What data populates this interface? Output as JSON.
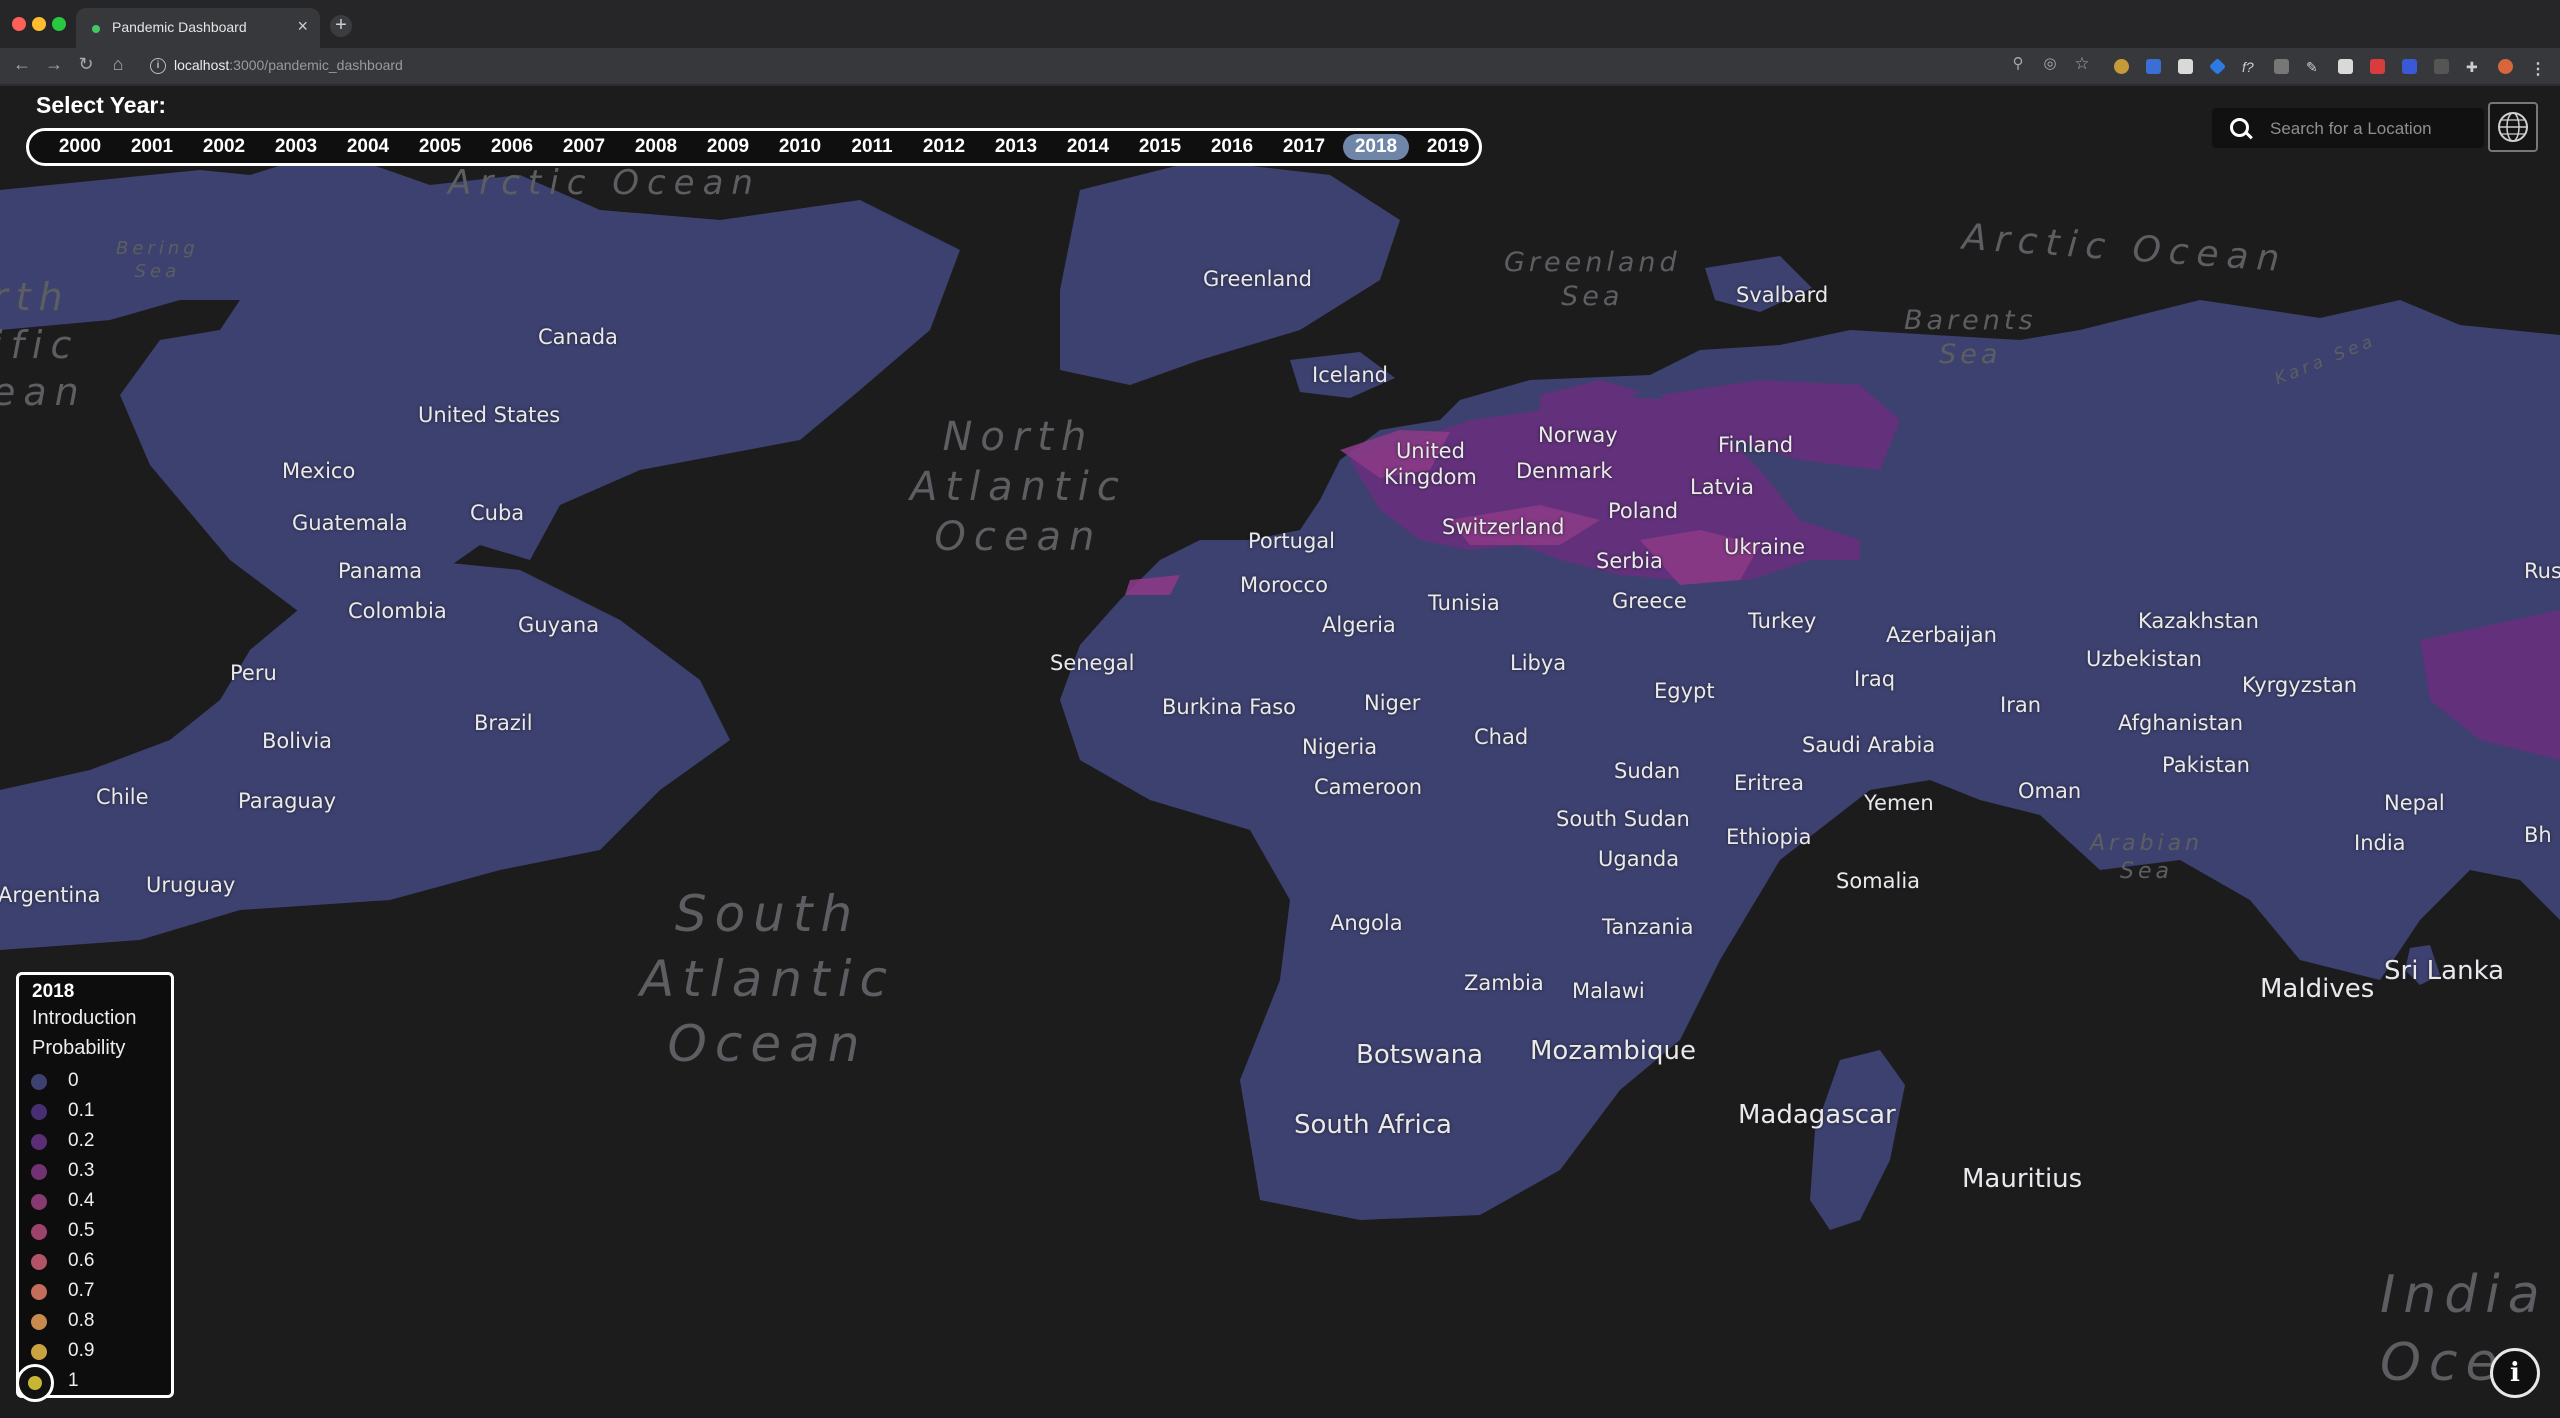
{
  "browser": {
    "tab_title": "Pandemic Dashboard",
    "url_host": "localhost",
    "url_path": ":3000/pandemic_dashboard",
    "tab_close": "×",
    "new_tab": "+"
  },
  "year_selector": {
    "title": "Select Year:",
    "years": [
      "2000",
      "2001",
      "2002",
      "2003",
      "2004",
      "2005",
      "2006",
      "2007",
      "2008",
      "2009",
      "2010",
      "2011",
      "2012",
      "2013",
      "2014",
      "2015",
      "2016",
      "2017",
      "2018",
      "2019"
    ],
    "selected": "2018"
  },
  "search": {
    "placeholder": "Search for a Location"
  },
  "legend": {
    "year": "2018",
    "title_line1": "Introduction",
    "title_line2": "Probability",
    "items": [
      {
        "value": "0",
        "color": "#3d4170"
      },
      {
        "value": "0.1",
        "color": "#472f74"
      },
      {
        "value": "0.2",
        "color": "#5a2d75"
      },
      {
        "value": "0.3",
        "color": "#703273"
      },
      {
        "value": "0.4",
        "color": "#873a6f"
      },
      {
        "value": "0.5",
        "color": "#9d426a"
      },
      {
        "value": "0.6",
        "color": "#b35466"
      },
      {
        "value": "0.7",
        "color": "#c26e5b"
      },
      {
        "value": "0.8",
        "color": "#c98a4e"
      },
      {
        "value": "0.9",
        "color": "#c9a342"
      },
      {
        "value": "1",
        "color": "#c7b634"
      }
    ]
  },
  "map": {
    "land_color": "#3d4170",
    "oceans": {
      "arctic_top": "Arctic Ocean",
      "arctic_right": "Arctic Ocean",
      "bering_1": "Bering",
      "bering_2": "Sea",
      "north_atlantic_1": "North",
      "north_atlantic_2": "Atlantic",
      "north_atlantic_3": "Ocean",
      "south_atlantic_1": "South",
      "south_atlantic_2": "Atlantic",
      "south_atlantic_3": "Ocean",
      "greenland_sea_1": "Greenland",
      "greenland_sea_2": "Sea",
      "barents_1": "Barents",
      "barents_2": "Sea",
      "kara": "Kara Sea",
      "arabian_1": "Arabian",
      "arabian_2": "Sea",
      "indian_1": "India",
      "indian_2": "Oce",
      "pacific_1": "rth",
      "pacific_2": "ific",
      "pacific_3": "ean"
    },
    "labels": {
      "greenland": "Greenland",
      "svalbard": "Svalbard",
      "iceland": "Iceland",
      "canada": "Canada",
      "united_states": "United States",
      "mexico": "Mexico",
      "guatemala": "Guatemala",
      "cuba": "Cuba",
      "panama": "Panama",
      "colombia": "Colombia",
      "guyana": "Guyana",
      "peru": "Peru",
      "brazil": "Brazil",
      "bolivia": "Bolivia",
      "chile": "Chile",
      "paraguay": "Paraguay",
      "argentina": "Argentina",
      "uruguay": "Uruguay",
      "united_kingdom_1": "United",
      "united_kingdom_2": "Kingdom",
      "norway": "Norway",
      "denmark": "Denmark",
      "finland": "Finland",
      "latvia": "Latvia",
      "poland": "Poland",
      "switzerland": "Switzerland",
      "portugal": "Portugal",
      "ukraine": "Ukraine",
      "serbia": "Serbia",
      "morocco": "Morocco",
      "greece": "Greece",
      "tunisia": "Tunisia",
      "algeria": "Algeria",
      "turkey": "Turkey",
      "azerbaijan": "Azerbaijan",
      "kazakhstan": "Kazakhstan",
      "uzbekistan": "Uzbekistan",
      "kyrgyzstan": "Kyrgyzstan",
      "russia": "Rus",
      "senegal": "Senegal",
      "libya": "Libya",
      "egypt": "Egypt",
      "iraq": "Iraq",
      "iran": "Iran",
      "afghanistan": "Afghanistan",
      "burkina_faso": "Burkina Faso",
      "niger": "Niger",
      "chad": "Chad",
      "nigeria": "Nigeria",
      "saudi_arabia": "Saudi Arabia",
      "pakistan": "Pakistan",
      "sudan": "Sudan",
      "eritrea": "Eritrea",
      "cameroon": "Cameroon",
      "yemen": "Yemen",
      "oman": "Oman",
      "nepal": "Nepal",
      "india": "India",
      "bhutan": "Bh",
      "south_sudan": "South Sudan",
      "ethiopia": "Ethiopia",
      "uganda": "Uganda",
      "somalia": "Somalia",
      "angola": "Angola",
      "tanzania": "Tanzania",
      "zambia": "Zambia",
      "malawi": "Malawi",
      "maldives": "Maldives",
      "sri_lanka": "Sri Lanka",
      "botswana": "Botswana",
      "mozambique": "Mozambique",
      "south_africa": "South Africa",
      "madagascar": "Madagascar",
      "mauritius": "Mauritius"
    }
  }
}
